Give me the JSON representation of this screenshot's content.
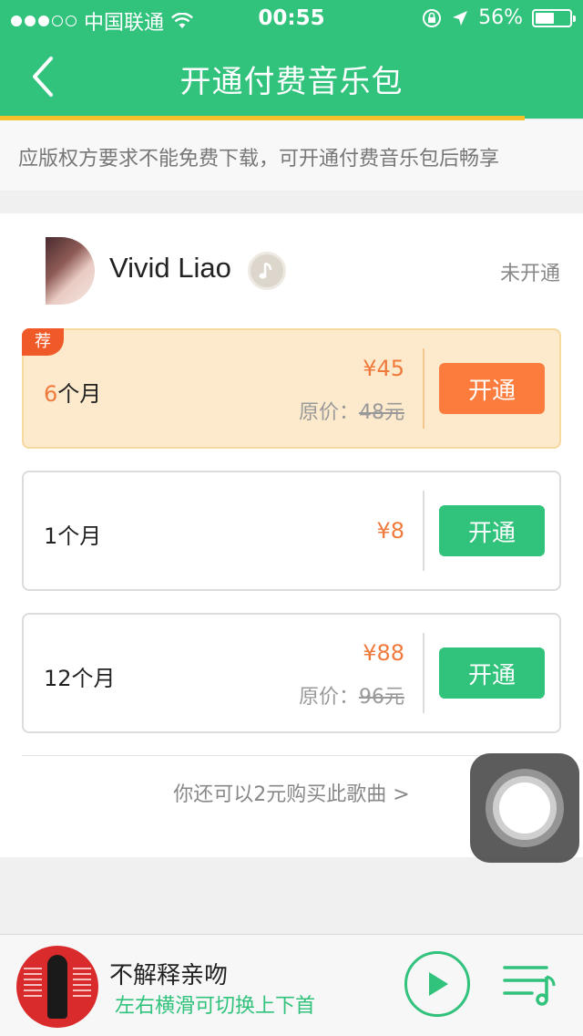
{
  "status_bar": {
    "carrier": "中国联通",
    "time": "00:55",
    "battery_text": "56%",
    "battery_level": 0.56
  },
  "navbar": {
    "title": "开通付费音乐包"
  },
  "notice": "应版权方要求不能免费下载，可开通付费音乐包后畅享",
  "artist": {
    "name": "Vivid Liao",
    "status": "未开通",
    "badge_icon": "music-note-icon"
  },
  "plans": [
    {
      "badge": "荐",
      "duration_number": "6",
      "duration_unit": "个月",
      "price": "¥45",
      "original_label": "原价：",
      "original_price": "48元",
      "button": "开通",
      "button_color": "#fb7c3c"
    },
    {
      "duration_number": "",
      "duration_unit": "1个月",
      "price": "¥8",
      "button": "开通",
      "button_color": "#31c27c"
    },
    {
      "duration_number": "",
      "duration_unit": "12个月",
      "price": "¥88",
      "original_label": "原价：",
      "original_price": "96元",
      "button": "开通",
      "button_color": "#31c27c"
    }
  ],
  "buy_song_link": "你还可以2元购买此歌曲 >",
  "player": {
    "song_title": "不解释亲吻",
    "hint": "左右横滑可切换上下首"
  },
  "colors": {
    "brand_green": "#31c27c",
    "accent_orange": "#fb7c3c",
    "price_orange": "#f07a3c",
    "progress_yellow": "#f7c12b"
  }
}
